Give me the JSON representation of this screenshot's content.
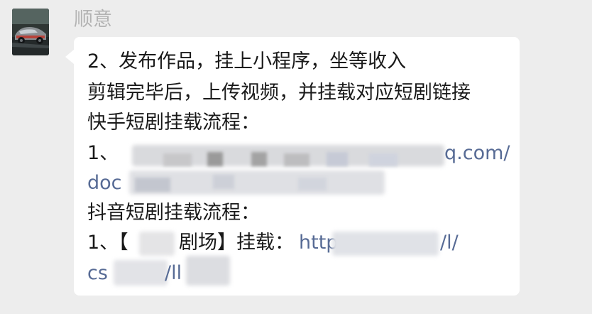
{
  "sender": {
    "name": "顺意"
  },
  "message": {
    "line1": "2、发布作品，挂上小程序，坐等收入",
    "line2": "剪辑完毕后，上传视频，并挂载对应短剧链接",
    "line3": "快手短剧挂载流程：",
    "line4_prefix": "1、",
    "line4_link_tail": "q.com/",
    "line5_link_head": "doc",
    "line6": "抖音短剧挂载流程：",
    "line7_prefix": "1、【",
    "line7_mid": "剧场】挂载：",
    "line7_link_head": "http",
    "line7_link_tail": "/l/",
    "line8_link_head": "cs",
    "line8_link_mid": "/ll"
  },
  "colors": {
    "background": "#ededed",
    "bubble": "#ffffff",
    "text": "#191919",
    "link": "#576b95",
    "sender_name": "#b3b3b3"
  },
  "icons": {
    "avatar": "car-photo-avatar"
  }
}
